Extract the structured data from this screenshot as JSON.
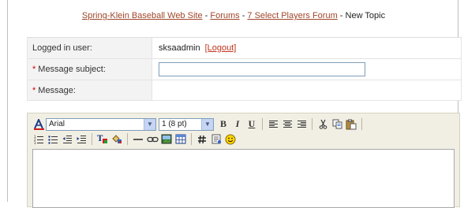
{
  "breadcrumb": {
    "site": "Spring-Klein Baseball Web Site",
    "sep1": " - ",
    "forums": "Forums",
    "sep2": " - ",
    "forum": "7 Select Players Forum",
    "sep3": " - ",
    "current": "New Topic"
  },
  "form": {
    "logged_label": "Logged in user:",
    "username": "sksaadmin",
    "logout": "[Logout]",
    "subject_label": "Message subject:",
    "subject_value": "",
    "message_label": "Message:",
    "required_mark": "*"
  },
  "toolbar": {
    "font": "Arial",
    "size": "1 (8 pt)",
    "bold": "B",
    "italic": "I",
    "underline": "U"
  },
  "colors": {
    "link": "#a0462a",
    "logout_link": "#c0341b",
    "required": "#d40000",
    "toolbar_bg": "#f1efe4"
  }
}
